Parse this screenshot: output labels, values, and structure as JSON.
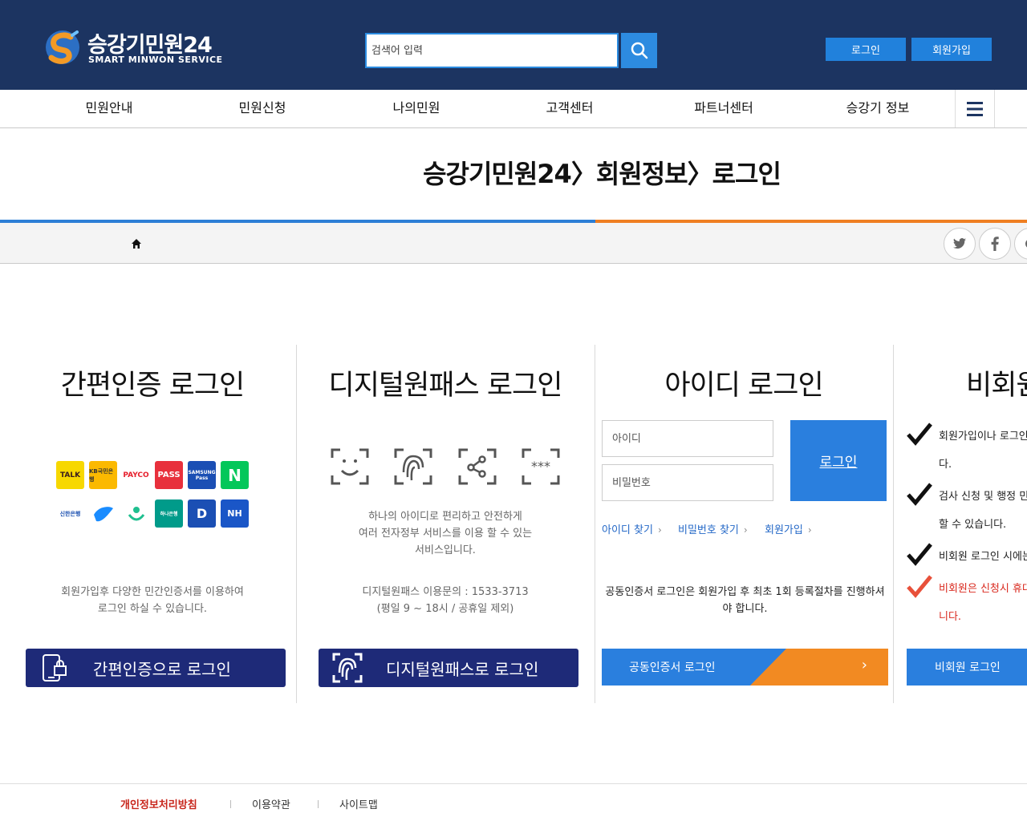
{
  "header": {
    "logo_title": "승강기민원24",
    "logo_sub": "SMART MINWON SERVICE",
    "search_placeholder": "검색어 입력",
    "login_label": "로그인",
    "join_label": "회원가입"
  },
  "gnb": {
    "items": [
      "민원안내",
      "민원신청",
      "나의민원",
      "고객센터",
      "파트너센터",
      "승강기 정보"
    ]
  },
  "page": {
    "title": "승강기민원24〉회원정보〉로그인"
  },
  "simple": {
    "title": "간편인증 로그인",
    "providers": [
      "TALK",
      "KB국민은행",
      "PAYCO",
      "PASS",
      "SAMSUNG Pass",
      "N",
      "신한은행",
      "토스",
      "카카오뱅크",
      "하나은행",
      "D",
      "NH"
    ],
    "desc": [
      "회원가입후 다양한 민간인증서를 이용하여",
      "로그인 하실 수 있습니다."
    ],
    "button_label": "간편인증으로 로그인"
  },
  "onepass": {
    "title": "디지털원패스 로그인",
    "desc": [
      "하나의 아이디로 편리하고 안전하게",
      "여러 전자정부 서비스를 이용 할 수 있는",
      "서비스입니다."
    ],
    "contact": [
      "디지털원패스 이용문의 : 1533-3713",
      "(평일 9 ~ 18시 / 공휴일 제외)"
    ],
    "button_label": "디지털원패스로 로그인"
  },
  "idlogin": {
    "title": "아이디 로그인",
    "id_placeholder": "아이디",
    "pw_placeholder": "비밀번호",
    "login_label": "로그인",
    "links": [
      "아이디 찾기",
      "비밀번호 찾기",
      "회원가입"
    ],
    "pki_note": "공동인증서 로그인은 회원가입 후 최초 1회 등록절차를 진행하셔야 합니다.",
    "pki_button": "공동인증서 로그인"
  },
  "nonmember": {
    "title": "비회원",
    "items": [
      {
        "line1": "회원가입이나 로그인",
        "line2": "다."
      },
      {
        "line1": "검사 신청 및 행정 민",
        "line2": "할 수 있습니다."
      },
      {
        "line1": "비회원 로그인 시에는",
        "line2": ""
      },
      {
        "line1": "비회원은 신청시 휴대",
        "line2": "니다."
      }
    ],
    "button_label": "비회원 로그인"
  },
  "footer": {
    "links": [
      "개인정보처리방침",
      "이용약관",
      "사이트맵"
    ]
  },
  "colors": {
    "header_bg": "#1c3461",
    "accent_blue": "#2a7fde",
    "accent_orange": "#ef7f22",
    "button_navy": "#1e2a78"
  }
}
